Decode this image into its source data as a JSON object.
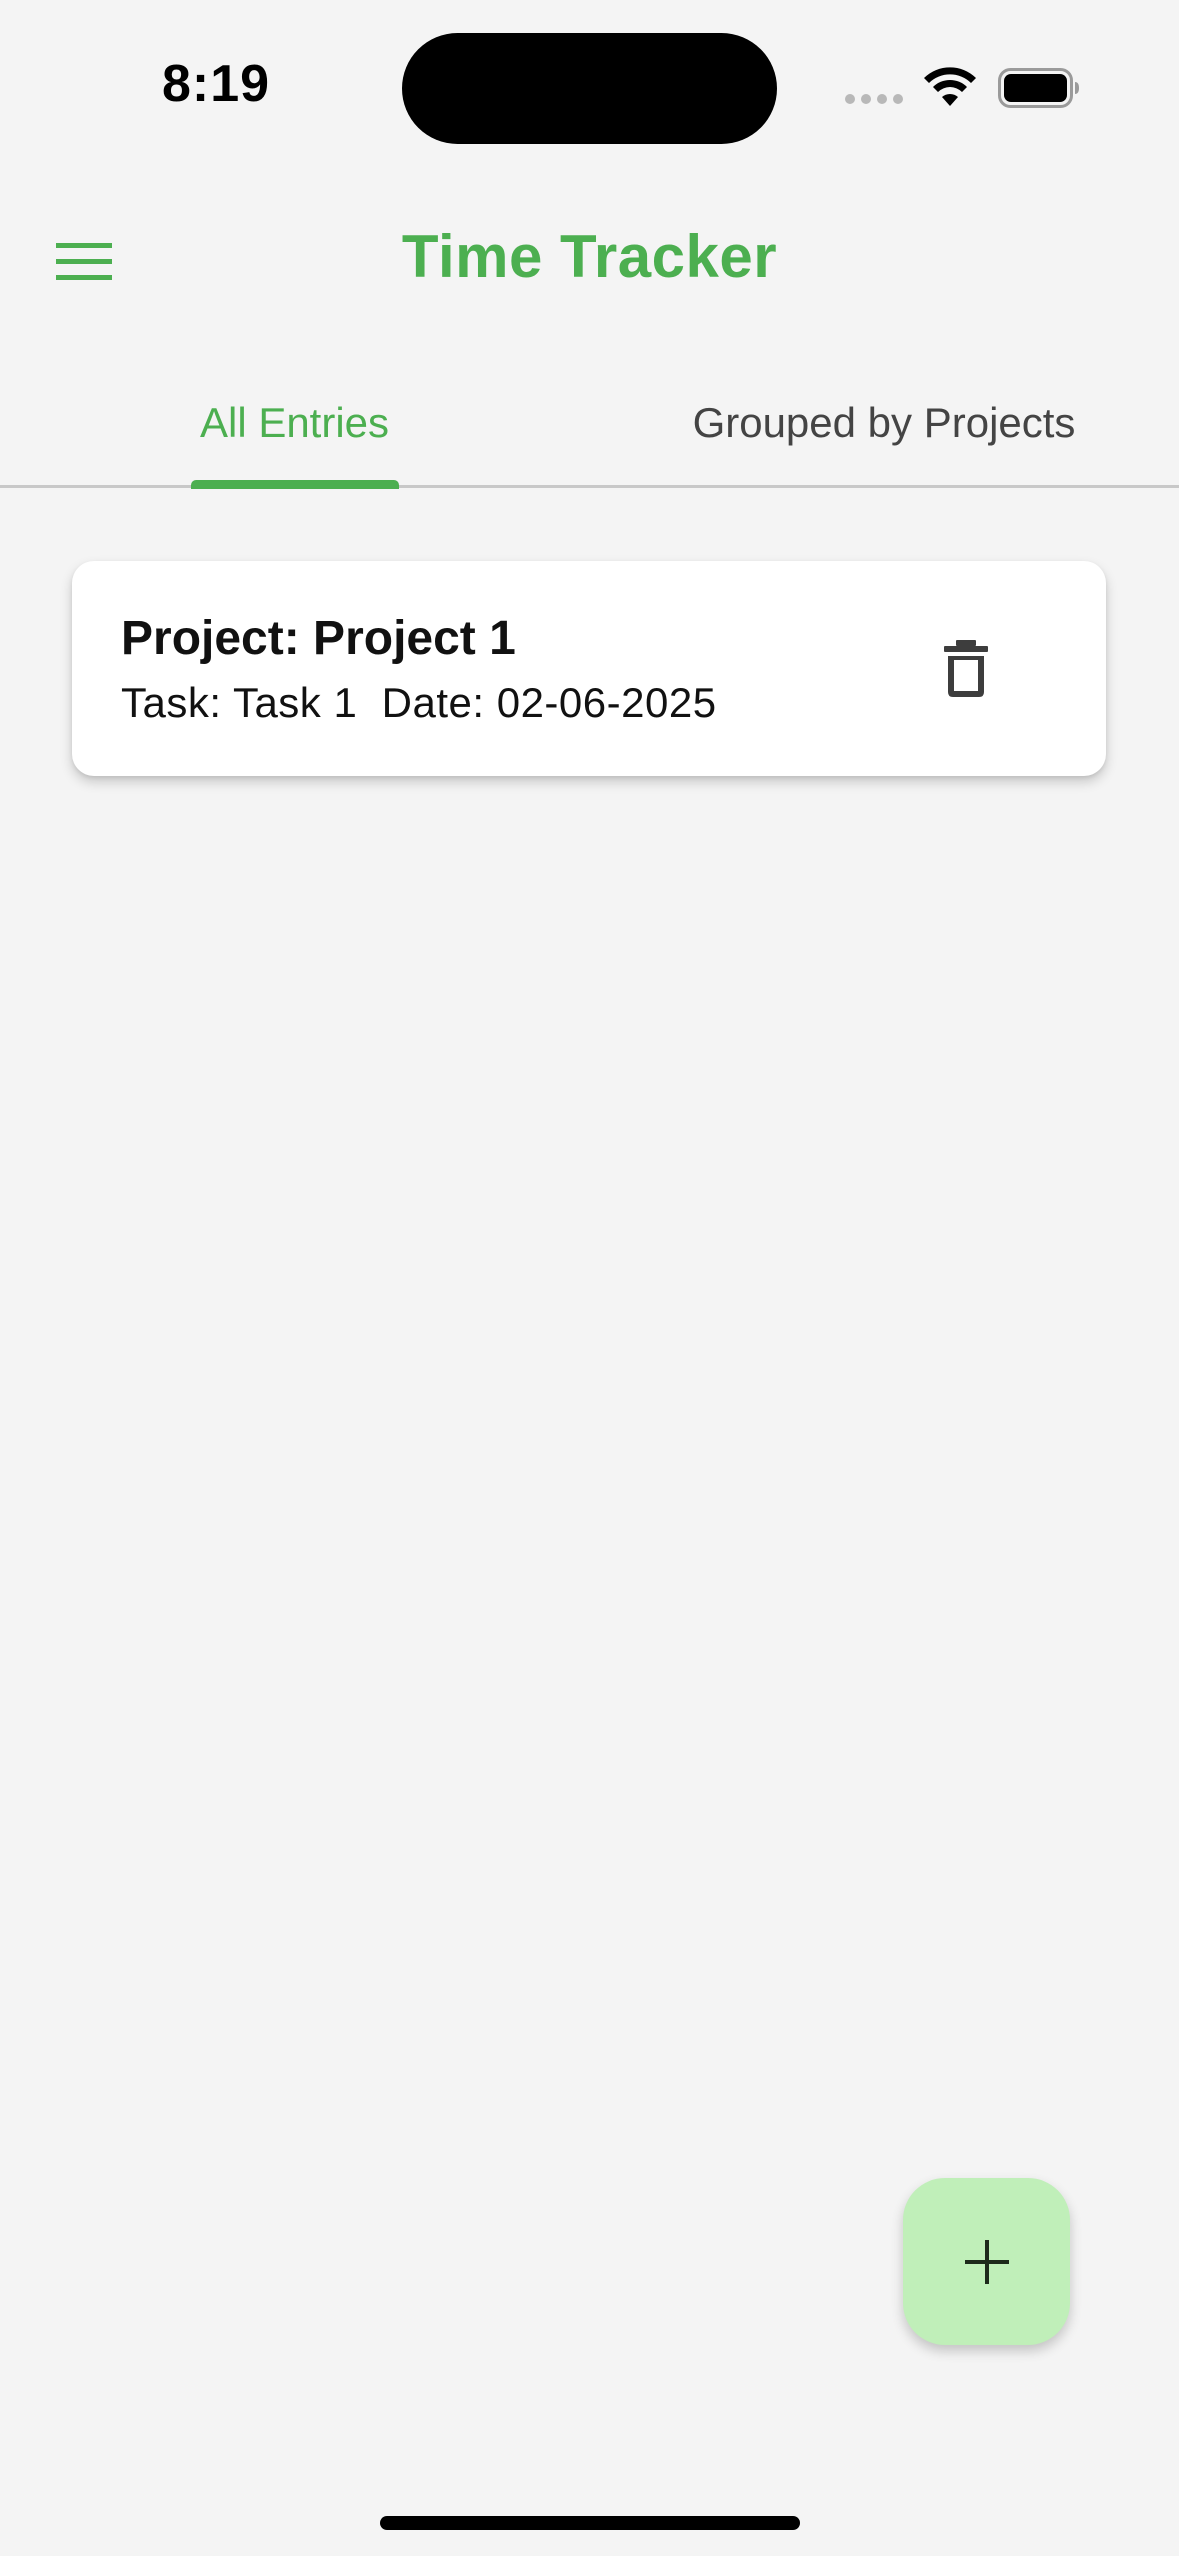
{
  "status_bar": {
    "time": "8:19",
    "icons": [
      "cellular-signal-icon",
      "wifi-icon",
      "battery-icon"
    ]
  },
  "app_bar": {
    "title": "Time Tracker",
    "menu_icon": "hamburger-menu-icon"
  },
  "tabs": [
    {
      "label": "All Entries",
      "selected": true
    },
    {
      "label": "Grouped by Projects",
      "selected": false
    }
  ],
  "entries": [
    {
      "project": "Project: Project 1",
      "details": "Task: Task 1  Date: 02-06-2025",
      "action_icon": "trash-icon"
    }
  ],
  "fab": {
    "icon": "plus-icon"
  },
  "colors": {
    "accent": "#4caf50",
    "background": "#f4f4f4",
    "fab_background": "#c0efb9",
    "card": "#ffffff"
  }
}
